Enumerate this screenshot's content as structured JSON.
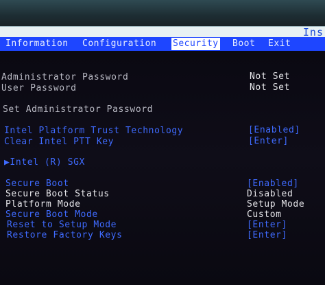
{
  "header": {
    "brand_text": "Ins"
  },
  "menu": {
    "items": [
      {
        "label": "Information"
      },
      {
        "label": "Configuration"
      },
      {
        "label": "Security",
        "active": true
      },
      {
        "label": "Boot"
      },
      {
        "label": "Exit"
      }
    ]
  },
  "security": {
    "admin_password": {
      "label": "Administrator Password",
      "value": "Not Set"
    },
    "user_password": {
      "label": "User Password",
      "value": "Not Set"
    },
    "set_admin_password": {
      "label": "Set Administrator Password"
    },
    "intel_ptt": {
      "label": "Intel Platform Trust Technology",
      "value": "[Enabled]"
    },
    "clear_ptt": {
      "label": "Clear Intel PTT Key",
      "value": "[Enter]"
    },
    "intel_sgx": {
      "label": "▶Intel (R) SGX"
    },
    "secure_boot": {
      "label": "Secure Boot",
      "value": "[Enabled]"
    },
    "secure_boot_status": {
      "label": "Secure Boot Status",
      "value": "Disabled"
    },
    "platform_mode": {
      "label": "Platform Mode",
      "value": "Setup Mode"
    },
    "secure_boot_mode": {
      "label": "Secure Boot Mode",
      "value": "Custom"
    },
    "reset_setup_mode": {
      "label": "Reset to Setup Mode",
      "value": "[Enter]"
    },
    "restore_factory_keys": {
      "label": "Restore Factory Keys",
      "value": "[Enter]"
    }
  },
  "colors": {
    "menu_bar": "#1e46ff",
    "link_text": "#3f6bff",
    "static_text": "#e6e6ea",
    "background": "#0b0a12"
  }
}
